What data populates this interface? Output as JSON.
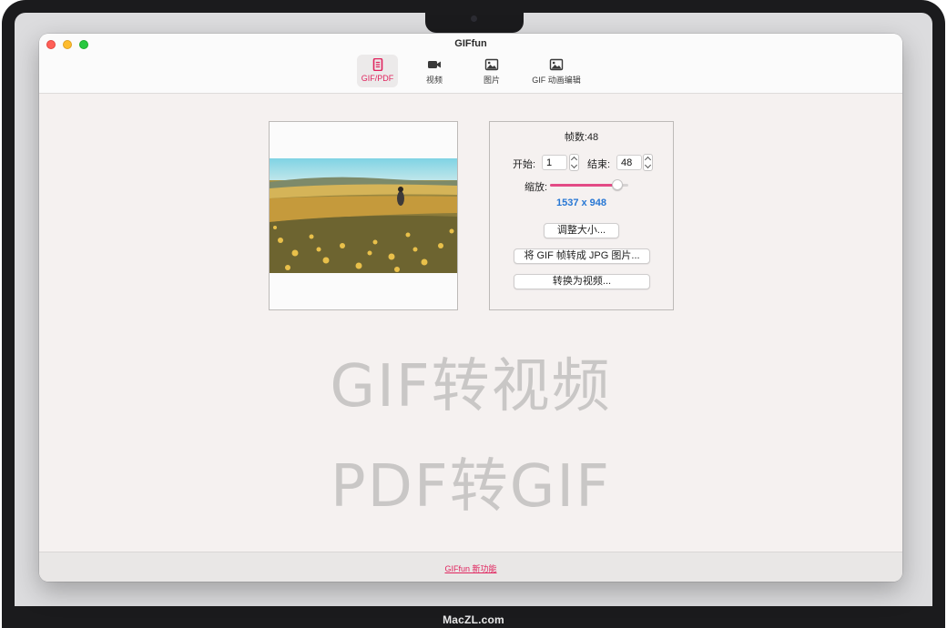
{
  "window": {
    "title": "GIFfun"
  },
  "toolbar": {
    "tabs": [
      {
        "label": "GIF/PDF",
        "icon": "document-icon",
        "active": true
      },
      {
        "label": "视频",
        "icon": "video-camera-icon",
        "active": false
      },
      {
        "label": "图片",
        "icon": "image-icon",
        "active": false
      },
      {
        "label": "GIF 动画编辑",
        "icon": "image-edit-icon",
        "active": false
      }
    ]
  },
  "panel": {
    "frame_count": "帧数:48",
    "start_label": "开始:",
    "start_value": "1",
    "end_label": "结束:",
    "end_value": "48",
    "scale_label": "缩放:",
    "scale_level": 0.86,
    "dimensions": "1537 x 948",
    "resize_button": "调整大小...",
    "export_jpg_button": "将 GIF 帧转成 JPG 图片...",
    "convert_video_button": "转换为视频..."
  },
  "watermark": {
    "line1": "GIF转视频",
    "line2": "PDF转GIF"
  },
  "footer": {
    "link": "GIFfun 新功能"
  },
  "device": {
    "brand": "MacZL.com"
  },
  "colors": {
    "accent": "#e0245e",
    "dimension_text": "#2777d4",
    "slider_fill": "#e34b86"
  }
}
